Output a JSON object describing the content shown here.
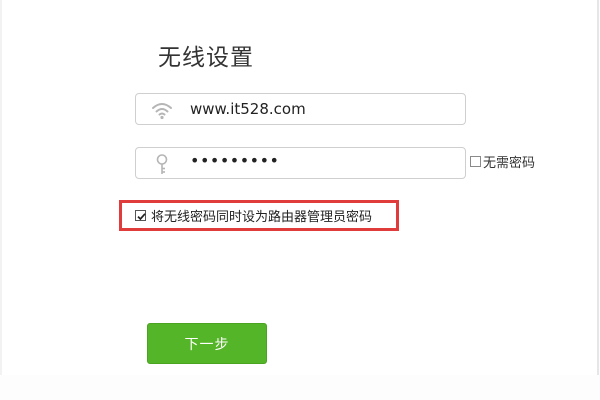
{
  "title": "无线设置",
  "ssid": {
    "icon": "wifi-icon",
    "value": "www.it528.com"
  },
  "password": {
    "icon": "key-icon",
    "value": "•••••••••"
  },
  "no_password": {
    "label": "无需密码",
    "checked": false
  },
  "admin_password_option": {
    "label": "将无线密码同时设为路由器管理员密码",
    "checked": true
  },
  "next_button": {
    "label": "下一步"
  },
  "colors": {
    "button": "#55b528",
    "highlight": "#e03c3c",
    "border": "#cfcfcf"
  }
}
